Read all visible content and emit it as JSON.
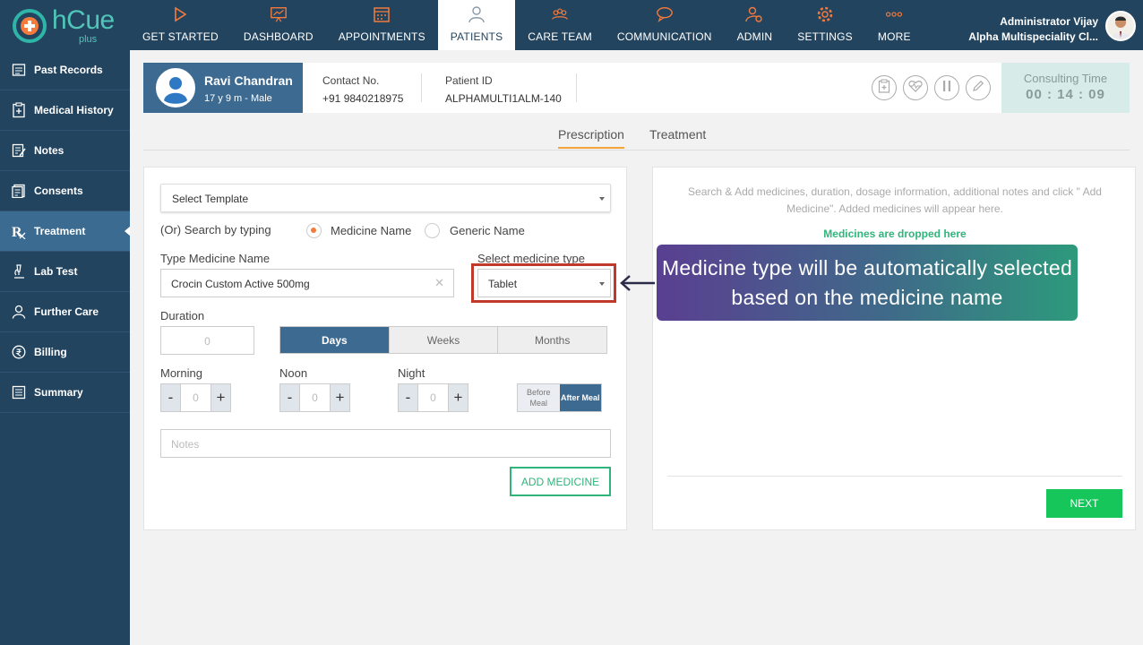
{
  "app": {
    "logo_text": "hCue",
    "logo_sub": "plus"
  },
  "nav": {
    "items": [
      {
        "label": "GET STARTED",
        "icon": "play-icon"
      },
      {
        "label": "DASHBOARD",
        "icon": "chart-board-icon"
      },
      {
        "label": "APPOINTMENTS",
        "icon": "calendar-icon"
      },
      {
        "label": "PATIENTS",
        "icon": "person-icon",
        "active": true
      },
      {
        "label": "CARE TEAM",
        "icon": "team-icon"
      },
      {
        "label": "COMMUNICATION",
        "icon": "chat-icon"
      },
      {
        "label": "ADMIN",
        "icon": "admin-gear-icon"
      },
      {
        "label": "SETTINGS",
        "icon": "gear-icon"
      },
      {
        "label": "MORE",
        "icon": "more-icon"
      }
    ],
    "accent_color": "#f47b3c"
  },
  "user": {
    "name": "Administrator Vijay",
    "org": "Alpha Multispeciality Cl..."
  },
  "sidebar": {
    "items": [
      {
        "label": "Past Records",
        "icon": "records-icon"
      },
      {
        "label": "Medical History",
        "icon": "clipboard-icon"
      },
      {
        "label": "Notes",
        "icon": "notes-icon"
      },
      {
        "label": "Consents",
        "icon": "consent-doc-icon"
      },
      {
        "label": "Treatment",
        "icon": "rx-icon",
        "active": true
      },
      {
        "label": "Lab Test",
        "icon": "microscope-icon"
      },
      {
        "label": "Further Care",
        "icon": "care-person-icon"
      },
      {
        "label": "Billing",
        "icon": "rupee-icon"
      },
      {
        "label": "Summary",
        "icon": "summary-icon"
      }
    ]
  },
  "patient": {
    "name": "Ravi Chandran",
    "meta": "17 y 9 m - Male",
    "contact_label": "Contact No.",
    "contact": "+91 9840218975",
    "id_label": "Patient ID",
    "id": "ALPHAMULTI1ALM-140",
    "consult_label": "Consulting Time",
    "consult_time": "00 : 14 : 09"
  },
  "tabs": [
    {
      "label": "Prescription",
      "active": true
    },
    {
      "label": "Treatment"
    }
  ],
  "form": {
    "template_placeholder": "Select Template",
    "search_by": "(Or) Search by typing",
    "radio_medicine": "Medicine Name",
    "radio_generic": "Generic Name",
    "medicine_label": "Type Medicine Name",
    "medicine_value": "Crocin Custom Active 500mg",
    "clear": "✕",
    "type_label": "Select medicine type",
    "type_value": "Tablet",
    "duration_label": "Duration",
    "duration_value": "0",
    "duration_units": [
      "Days",
      "Weeks",
      "Months"
    ],
    "morning": "Morning",
    "noon": "Noon",
    "night": "Night",
    "dose_value": "0",
    "minus": "-",
    "plus": "+",
    "before_meal": "Before Meal",
    "after_meal": "After Meal",
    "notes_placeholder": "Notes",
    "add_button": "ADD MEDICINE"
  },
  "right": {
    "hint": "Search & Add medicines, duration, dosage information, additional notes and click \" Add Medicine\". Added medicines will appear here.",
    "drop": "Medicines are dropped here",
    "next": "NEXT"
  },
  "callout": {
    "text": "Medicine type will be automatically selected based on the medicine name"
  }
}
